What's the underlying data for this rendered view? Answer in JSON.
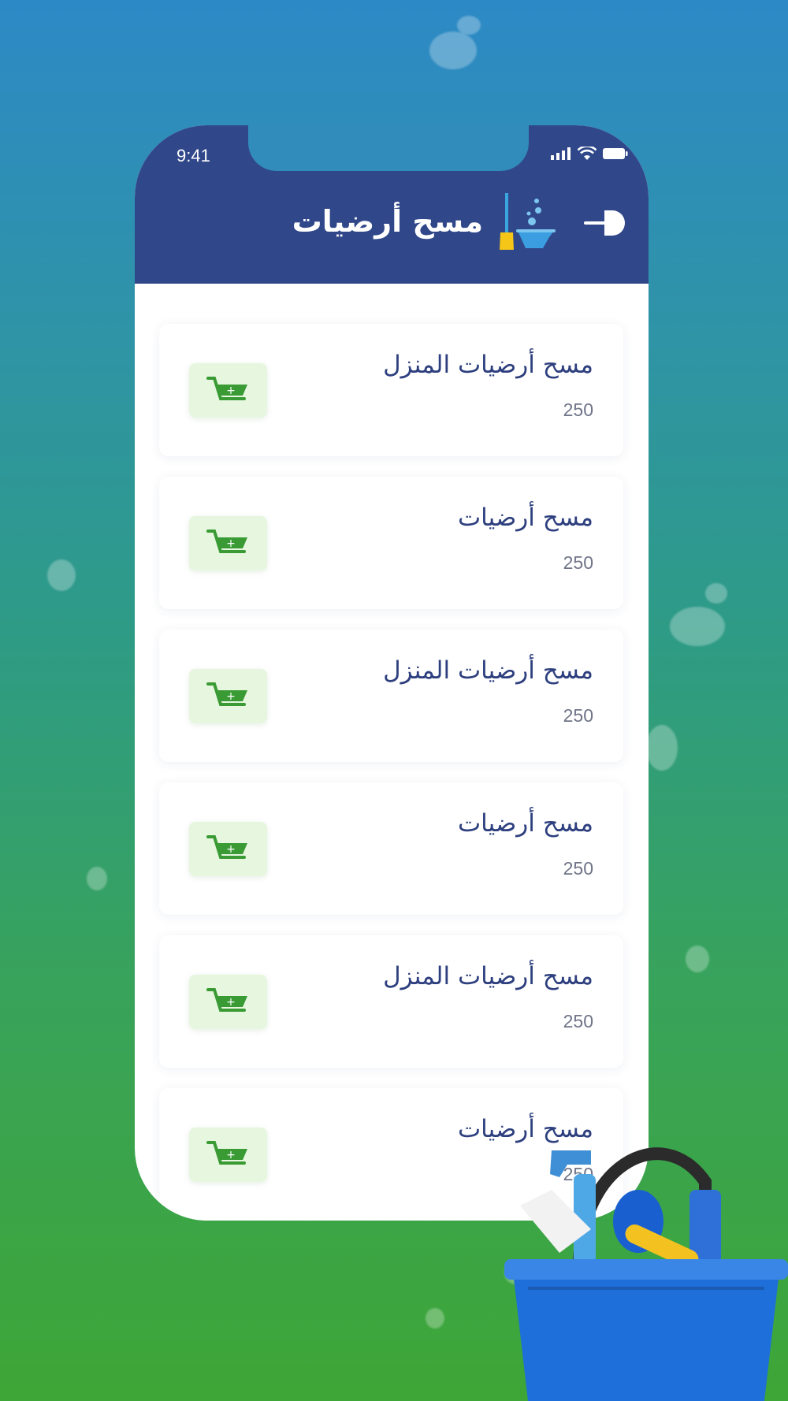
{
  "status_bar": {
    "time": "9:41"
  },
  "header": {
    "title": "مسح أرضيات"
  },
  "products": [
    {
      "name": "مسح أرضيات المنزل",
      "price": "250"
    },
    {
      "name": "مسح أرضيات",
      "price": "250"
    },
    {
      "name": "مسح أرضيات المنزل",
      "price": "250"
    },
    {
      "name": "مسح أرضيات",
      "price": "250"
    },
    {
      "name": "مسح أرضيات المنزل",
      "price": "250"
    },
    {
      "name": "مسح أرضيات",
      "price": "250"
    }
  ],
  "icons": {
    "back": "arrow-right-icon",
    "header": "broom-bucket-icon",
    "cart": "add-to-cart-icon"
  },
  "colors": {
    "header": "#30488a",
    "accent_green": "#3a9b35",
    "cart_bg": "#e6f6df",
    "text_primary": "#2d3f7e"
  }
}
